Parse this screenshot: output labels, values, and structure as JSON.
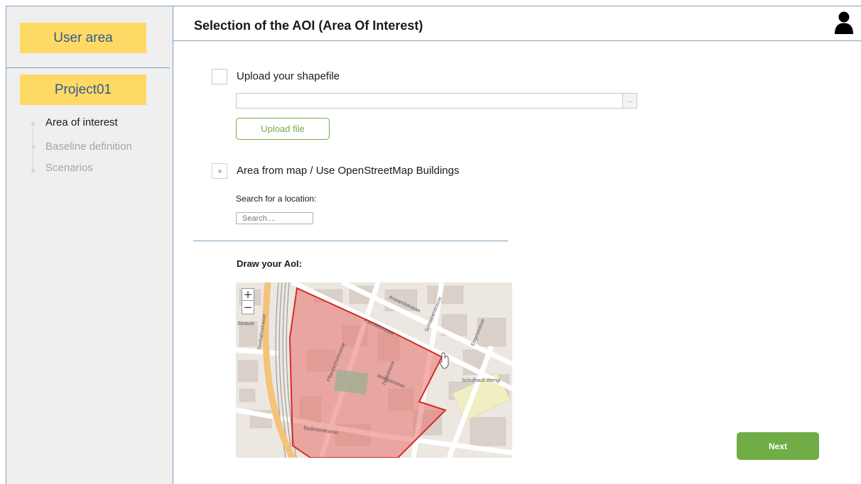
{
  "sidebar": {
    "user_area_label": "User area",
    "project_label": "Project01",
    "steps": [
      {
        "label": "Area of interest",
        "active": true
      },
      {
        "label": "Baseline definition",
        "active": false
      },
      {
        "label": "Scenarios",
        "active": false
      }
    ]
  },
  "header": {
    "title": "Selection of the AOI (Area Of Interest)",
    "user_icon": "user-icon"
  },
  "upload_option": {
    "label": "Upload your shapefile",
    "checked": false,
    "file_value": "",
    "browse_label": "...",
    "upload_button_label": "Upload file"
  },
  "map_option": {
    "label": "Area from map / Use OpenStreetMap Buildings",
    "search_label": "Search for a location:",
    "search_placeholder": "Search...."
  },
  "draw": {
    "label": "Draw your AoI:",
    "zoom_in": "+",
    "zoom_out": "−",
    "street_names": [
      "Anwandstrasse",
      "Kanzleistrasse",
      "Schreinerstrasse",
      "Engelstrasse",
      "Seebahnstrasse",
      "Pflanzschulstrasse",
      "Feldstrasse",
      "Wengistrasse",
      "Badenerstrasse",
      "Schulhaus Wengi",
      "Strasse"
    ]
  },
  "actions": {
    "next_label": "Next"
  },
  "colors": {
    "accent_yellow": "#ffd966",
    "accent_green": "#70ad47",
    "link_blue": "#2e5d8a",
    "aoi_fill": "#e8716b",
    "aoi_stroke": "#d62a2a"
  }
}
